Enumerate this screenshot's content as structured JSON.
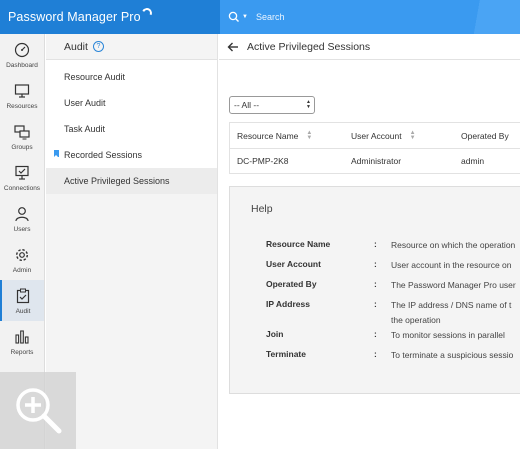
{
  "app": {
    "brand": "Password Manager Pro"
  },
  "search": {
    "label": "Search"
  },
  "leftnav": {
    "items": [
      {
        "label": "Dashboard",
        "icon": "dashboard-icon"
      },
      {
        "label": "Resources",
        "icon": "monitor-icon"
      },
      {
        "label": "Groups",
        "icon": "groups-icon"
      },
      {
        "label": "Connections",
        "icon": "connections-icon"
      },
      {
        "label": "Users",
        "icon": "user-icon"
      },
      {
        "label": "Admin",
        "icon": "gear-icon"
      },
      {
        "label": "Audit",
        "icon": "clipboard-check-icon"
      },
      {
        "label": "Reports",
        "icon": "bar-chart-icon"
      }
    ],
    "active": "Audit"
  },
  "subnav": {
    "title": "Audit",
    "help_glyph": "?",
    "items": [
      {
        "label": "Resource Audit"
      },
      {
        "label": "User Audit"
      },
      {
        "label": "Task Audit"
      },
      {
        "label": "Recorded Sessions"
      },
      {
        "label": "Active Privileged Sessions"
      }
    ],
    "active": "Active Privileged Sessions"
  },
  "main": {
    "title": "Active Privileged Sessions",
    "filter": {
      "selected": "-- All --"
    },
    "table": {
      "columns": [
        "Resource Name",
        "User Account",
        "Operated By"
      ],
      "rows": [
        [
          "DC-PMP-2K8",
          "Administrator",
          "admin"
        ]
      ]
    },
    "help": {
      "title": "Help",
      "colon": ":",
      "entries": [
        {
          "term": "Resource Name",
          "desc": "Resource on which the operation"
        },
        {
          "term": "User Account",
          "desc": "User account in the resource on"
        },
        {
          "term": "Operated By",
          "desc": "The Password Manager Pro user"
        },
        {
          "term": "IP Address",
          "desc": "The IP address / DNS name of t",
          "desc2": "the operation"
        },
        {
          "term": "Join",
          "desc": "To monitor sessions in parallel"
        },
        {
          "term": "Terminate",
          "desc": "To terminate a suspicious sessio"
        }
      ]
    }
  },
  "colors": {
    "brand_blue": "#1f7fd6",
    "search_blue": "#3a9af0",
    "accent": "#2b86d8"
  }
}
